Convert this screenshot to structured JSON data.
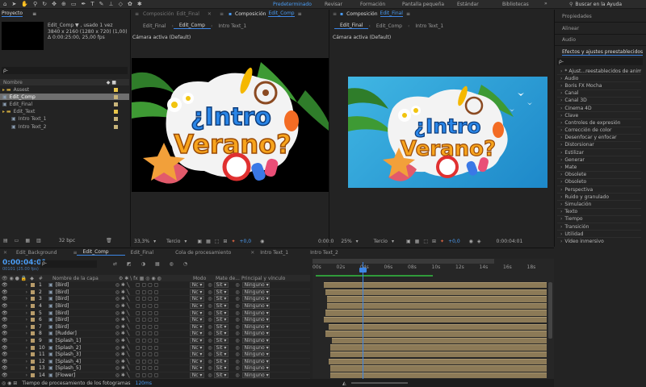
{
  "toolbar": {
    "workspaces": [
      "Predeterminado",
      "Revisar",
      "Formación",
      "Pantalla pequeña",
      "Estándar",
      "Bibliotecas"
    ],
    "search_placeholder": "Buscar en la Ayuda"
  },
  "project": {
    "title": "Proyecto",
    "comp_name": "Edit_Comp ▼ , usado 1 vez",
    "comp_size": "3840 x 2160 (1280 x 720) (1,00)",
    "comp_duration": "Δ 0:00:25:00, 25,00 fps",
    "search_icon_label": "ρ-",
    "column_name": "Nombre",
    "items": [
      {
        "name": "Assest",
        "type": "folder",
        "label_color": "#e8c54a"
      },
      {
        "name": "Edit_Comp",
        "type": "comp",
        "label_color": "#c8b47a",
        "selected": true
      },
      {
        "name": "Edit_Final",
        "type": "comp",
        "label_color": "#c8b47a"
      },
      {
        "name": "Edit_Text",
        "type": "folder",
        "label_color": "#e8c54a"
      },
      {
        "name": "Intro Text_1",
        "type": "comp",
        "label_color": "#c8b47a"
      },
      {
        "name": "Intro Text_2",
        "type": "comp",
        "label_color": "#c8b47a"
      }
    ],
    "bpc": "32 bpc"
  },
  "viewer_left": {
    "header": "Composición",
    "header_comp": "Edit_Final",
    "tabs": [
      "Edit_Final",
      "Edit_Comp",
      "Intro Text_1"
    ],
    "active_tab": "Edit_Comp",
    "camera": "Cámara activa (Default)",
    "zoom": "33,3%",
    "resolution": "Tercio",
    "exposure": "+0,0"
  },
  "viewer_right": {
    "header_prefix": "Composición",
    "header_comp": "Edit_Final",
    "tabs": [
      "Edit_Final",
      "Edit_Comp",
      "Intro Text_1"
    ],
    "active_tab": "Edit_Final",
    "camera": "Cámara activa (Default)",
    "time_left": "0:00:0",
    "zoom": "25%",
    "resolution": "Tercio",
    "exposure": "+0,0",
    "time": "0:00:04:01"
  },
  "artwork": {
    "line1": "¿Intro",
    "line2": "Verano?"
  },
  "right_panel": {
    "sections": [
      "Propiedades",
      "Alinear",
      "Audio"
    ],
    "effects_title": "Efectos y ajustes preestablecidos",
    "search": "ρ-",
    "effects": [
      "* Ajust...reestablecidos de animación",
      "Audio",
      "Boris FX Mocha",
      "Canal",
      "Canal 3D",
      "Cinema 4D",
      "Clave",
      "Controles de expresión",
      "Corrección de color",
      "Desenfocar y enfocar",
      "Distorsionar",
      "Estilizar",
      "Generar",
      "Mate",
      "Obsolete",
      "Obsoleto",
      "Perspectiva",
      "Ruido y granulado",
      "Simulación",
      "Texto",
      "Tiempo",
      "Transición",
      "Utilidad",
      "Vídeo inmersivo"
    ]
  },
  "timeline": {
    "tabs": [
      "Edit_Background",
      "Edit_Comp",
      "Edit_Final",
      "Cola de procesamiento",
      "Intro Text_1",
      "Intro Text_2"
    ],
    "active_tab": "Edit_Comp",
    "current_time": "0:00:04:01",
    "frame_info": "00101 (25.00 fps)",
    "columns": {
      "number": "#",
      "layer_name": "Nombre de la capa",
      "mode": "Modo",
      "track_matte": "Mate de...",
      "parent": "Principal y vínculo"
    },
    "ruler": [
      "00s",
      "02s",
      "04s",
      "06s",
      "08s",
      "10s",
      "12s",
      "14s",
      "16s",
      "18s"
    ],
    "layers": [
      {
        "num": "1",
        "name": "[Bird]"
      },
      {
        "num": "2",
        "name": "[Bird]"
      },
      {
        "num": "3",
        "name": "[Bird]"
      },
      {
        "num": "4",
        "name": "[Bird]"
      },
      {
        "num": "5",
        "name": "[Bird]"
      },
      {
        "num": "6",
        "name": "[Bird]"
      },
      {
        "num": "7",
        "name": "[Bird]"
      },
      {
        "num": "8",
        "name": "[Rudder]"
      },
      {
        "num": "9",
        "name": "[Splash_1]"
      },
      {
        "num": "10",
        "name": "[Splash_2]"
      },
      {
        "num": "11",
        "name": "[Splash_3]"
      },
      {
        "num": "12",
        "name": "[Splash_4]"
      },
      {
        "num": "13",
        "name": "[Splash_5]"
      },
      {
        "num": "14",
        "name": "[Flower]"
      }
    ],
    "mode_value": "Nc",
    "matte_value": "Sit",
    "parent_value": "Ninguno",
    "footer_label": "Tiempo de procesamiento de los fotogramas",
    "footer_value": "120ms"
  }
}
